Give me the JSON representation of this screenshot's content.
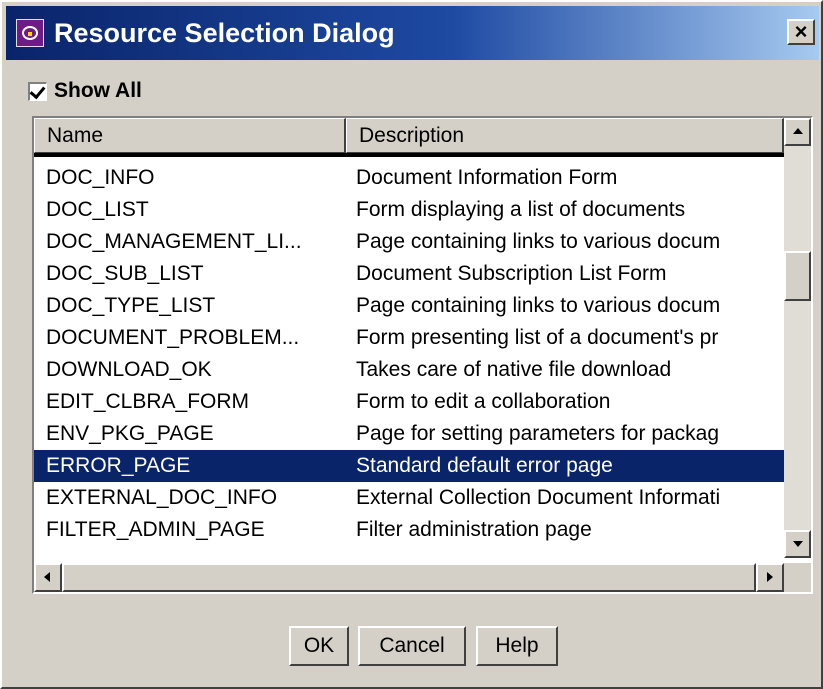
{
  "window": {
    "title": "Resource Selection Dialog",
    "close_glyph": "×",
    "icon": "app-icon",
    "colors": {
      "titlebar_start": "#0a246a",
      "titlebar_end": "#a6caf0",
      "selection": "#0a246a",
      "face": "#d4d0c8"
    }
  },
  "filter": {
    "show_all_label": "Show All",
    "show_all_checked": true
  },
  "table": {
    "columns": [
      "Name",
      "Description"
    ],
    "rows": [
      {
        "name": "DOC_INFO",
        "description": "Document Information Form"
      },
      {
        "name": "DOC_LIST",
        "description": "Form displaying a list of documents"
      },
      {
        "name": "DOC_MANAGEMENT_LI...",
        "description": "Page containing links to various docum"
      },
      {
        "name": "DOC_SUB_LIST",
        "description": "Document Subscription List Form"
      },
      {
        "name": "DOC_TYPE_LIST",
        "description": "Page containing links to various docum"
      },
      {
        "name": "DOCUMENT_PROBLEM...",
        "description": "Form presenting list of a document's pr"
      },
      {
        "name": "DOWNLOAD_OK",
        "description": "Takes care of native file download"
      },
      {
        "name": "EDIT_CLBRA_FORM",
        "description": "Form to edit a collaboration"
      },
      {
        "name": "ENV_PKG_PAGE",
        "description": "Page for setting parameters for packag"
      },
      {
        "name": "ERROR_PAGE",
        "description": "Standard default error page"
      },
      {
        "name": "EXTERNAL_DOC_INFO",
        "description": "External Collection Document Informati"
      },
      {
        "name": "FILTER_ADMIN_PAGE",
        "description": "Filter administration page"
      }
    ],
    "selected_row_index": 9
  },
  "buttons": {
    "ok": "OK",
    "cancel": "Cancel",
    "help": "Help"
  }
}
